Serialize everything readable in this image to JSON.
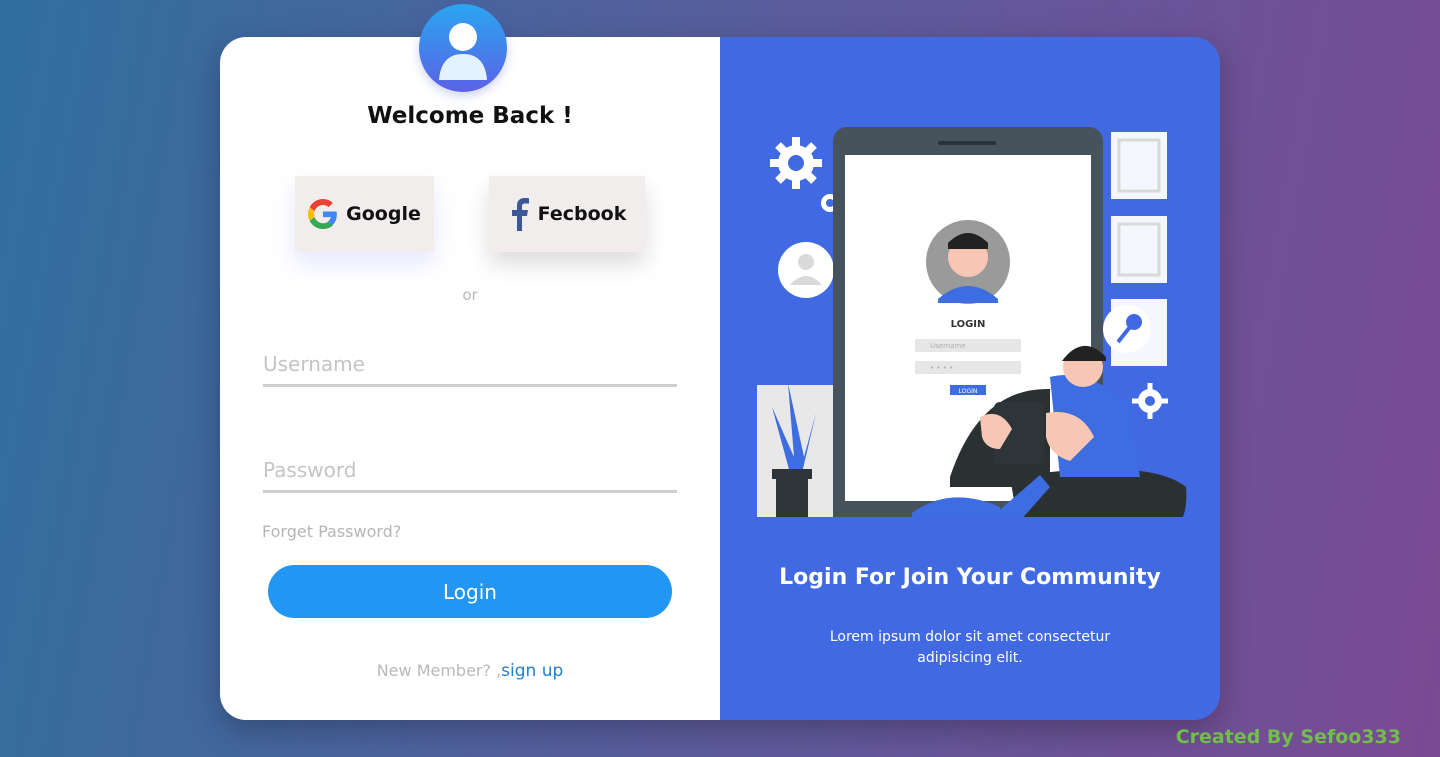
{
  "left_panel": {
    "welcome_title": "Welcome Back !",
    "google_label": "Google",
    "facebook_label": "Fecbook",
    "or_text": "or",
    "username_placeholder": "Username",
    "password_placeholder": "Password",
    "forgot_link": "Forget Password?",
    "login_button": "Login",
    "new_member_text": "New Member? ,",
    "signup_link": "sign up"
  },
  "right_panel": {
    "title": "Login For Join Your Community",
    "description": "Lorem ipsum dolor sit amet consectetur adipisicing elit.",
    "illustration": {
      "login_label": "LOGIN",
      "username_placeholder": "Username",
      "password_mask": "• • • •",
      "button_label": "LOGIN"
    }
  },
  "footer": {
    "credit": "Created By Sefoo333"
  },
  "colors": {
    "accent": "#2196f3",
    "right_panel_bg": "#4169e1",
    "credit_color": "#6fbf4a",
    "card_bg": "#ffffff"
  },
  "icons": [
    "user-avatar-icon",
    "google-icon",
    "facebook-icon",
    "gear-icon"
  ]
}
